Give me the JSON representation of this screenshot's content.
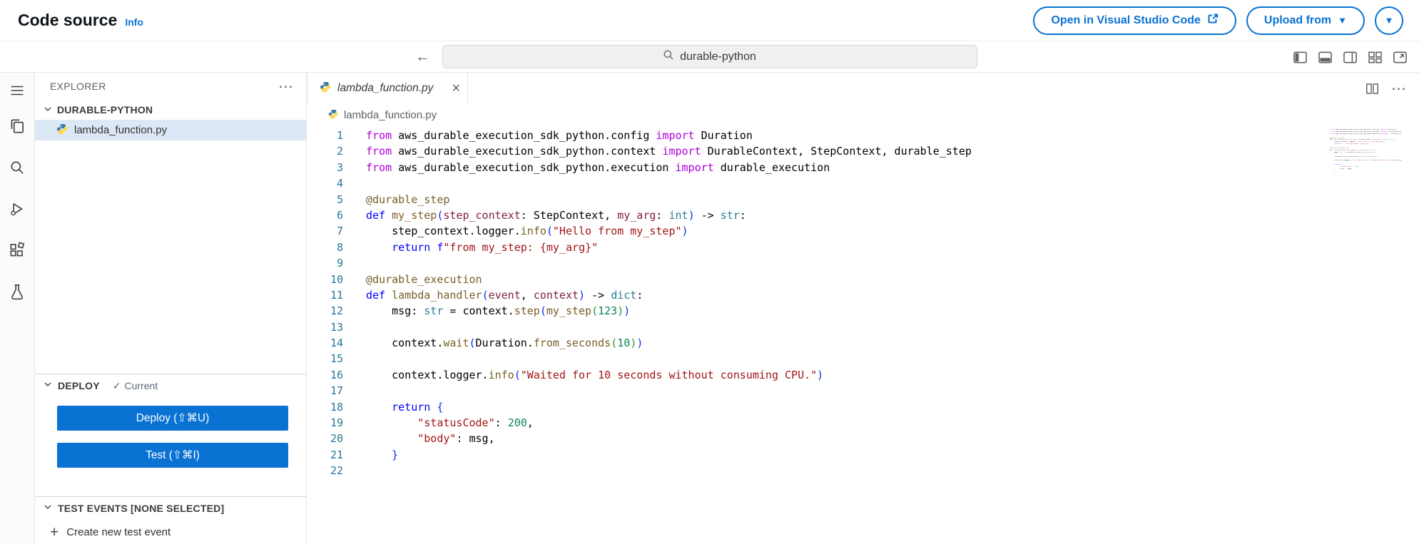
{
  "theme": {
    "accent_blue": "#0972d3",
    "deploy_button_bg": "#0972d3",
    "selected_file_bg": "#dde8f6",
    "line_number_color": "#237893",
    "string_color": "#a31515",
    "keyword_color": "#af00db"
  },
  "icons": {
    "back": "←",
    "forward": "→",
    "more": "⋯",
    "close": "×",
    "plus": "+",
    "check": "✓",
    "caret_down": "▼"
  },
  "header": {
    "title": "Code source",
    "info_link": "Info",
    "open_vscode_button": "Open in Visual Studio Code",
    "upload_from_button": "Upload from"
  },
  "titlebar": {
    "search_value": "durable-python"
  },
  "sidebar": {
    "explorer_title": "EXPLORER",
    "folder_name": "DURABLE-PYTHON",
    "files": [
      {
        "name": "lambda_function.py",
        "selected": true
      }
    ],
    "deploy": {
      "title": "DEPLOY",
      "status": "Current",
      "deploy_button": "Deploy (⇧⌘U)",
      "test_button": "Test (⇧⌘I)"
    },
    "test_events": {
      "title": "TEST EVENTS [NONE SELECTED]",
      "create_label": "Create new test event"
    }
  },
  "editor": {
    "tab_label": "lambda_function.py",
    "breadcrumb": "lambda_function.py",
    "code_lines": [
      [
        [
          "kw",
          "from"
        ],
        [
          "pl",
          " aws_durable_execution_sdk_python.config "
        ],
        [
          "kw",
          "import"
        ],
        [
          "pl",
          " Duration"
        ]
      ],
      [
        [
          "kw",
          "from"
        ],
        [
          "pl",
          " aws_durable_execution_sdk_python.context "
        ],
        [
          "kw",
          "import"
        ],
        [
          "pl",
          " DurableContext, StepContext, durable_step"
        ]
      ],
      [
        [
          "kw",
          "from"
        ],
        [
          "pl",
          " aws_durable_execution_sdk_python.execution "
        ],
        [
          "kw",
          "import"
        ],
        [
          "pl",
          " durable_execution"
        ]
      ],
      [],
      [
        [
          "dec",
          "@durable_step"
        ]
      ],
      [
        [
          "df",
          "def"
        ],
        [
          "pl",
          " "
        ],
        [
          "fn",
          "my_step"
        ],
        [
          "br",
          "("
        ],
        [
          "par",
          "step_context"
        ],
        [
          "pl",
          ": StepContext, "
        ],
        [
          "par",
          "my_arg"
        ],
        [
          "pl",
          ": "
        ],
        [
          "ty",
          "int"
        ],
        [
          "br",
          ")"
        ],
        [
          "pl",
          " -> "
        ],
        [
          "ty",
          "str"
        ],
        [
          "pl",
          ":"
        ]
      ],
      [
        [
          "pl",
          "    step_context.logger."
        ],
        [
          "fn",
          "info"
        ],
        [
          "br",
          "("
        ],
        [
          "str",
          "\"Hello from my_step\""
        ],
        [
          "br",
          ")"
        ]
      ],
      [
        [
          "pl",
          "    "
        ],
        [
          "df",
          "return"
        ],
        [
          "pl",
          " "
        ],
        [
          "df",
          "f"
        ],
        [
          "str",
          "\"from my_step: {my_arg}\""
        ]
      ],
      [],
      [
        [
          "dec",
          "@durable_execution"
        ]
      ],
      [
        [
          "df",
          "def"
        ],
        [
          "pl",
          " "
        ],
        [
          "fn",
          "lambda_handler"
        ],
        [
          "br",
          "("
        ],
        [
          "par",
          "event"
        ],
        [
          "pl",
          ", "
        ],
        [
          "par",
          "context"
        ],
        [
          "br",
          ")"
        ],
        [
          "pl",
          " -> "
        ],
        [
          "ty",
          "dict"
        ],
        [
          "pl",
          ":"
        ]
      ],
      [
        [
          "pl",
          "    msg: "
        ],
        [
          "ty",
          "str"
        ],
        [
          "pl",
          " = context."
        ],
        [
          "fn",
          "step"
        ],
        [
          "br",
          "("
        ],
        [
          "fn",
          "my_step"
        ],
        [
          "br2",
          "("
        ],
        [
          "num",
          "123"
        ],
        [
          "br2",
          ")"
        ],
        [
          "br",
          ")"
        ]
      ],
      [],
      [
        [
          "pl",
          "    context."
        ],
        [
          "fn",
          "wait"
        ],
        [
          "br",
          "("
        ],
        [
          "pl",
          "Duration."
        ],
        [
          "fn",
          "from_seconds"
        ],
        [
          "br2",
          "("
        ],
        [
          "num",
          "10"
        ],
        [
          "br2",
          ")"
        ],
        [
          "br",
          ")"
        ]
      ],
      [],
      [
        [
          "pl",
          "    context.logger."
        ],
        [
          "fn",
          "info"
        ],
        [
          "br",
          "("
        ],
        [
          "str",
          "\"Waited for 10 seconds without consuming CPU.\""
        ],
        [
          "br",
          ")"
        ]
      ],
      [],
      [
        [
          "pl",
          "    "
        ],
        [
          "df",
          "return"
        ],
        [
          "pl",
          " "
        ],
        [
          "br",
          "{"
        ]
      ],
      [
        [
          "pl",
          "        "
        ],
        [
          "str",
          "\"statusCode\""
        ],
        [
          "pl",
          ": "
        ],
        [
          "num",
          "200"
        ],
        [
          "pl",
          ","
        ]
      ],
      [
        [
          "pl",
          "        "
        ],
        [
          "str",
          "\"body\""
        ],
        [
          "pl",
          ": msg,"
        ]
      ],
      [
        [
          "pl",
          "    "
        ],
        [
          "br",
          "}"
        ]
      ],
      []
    ]
  }
}
